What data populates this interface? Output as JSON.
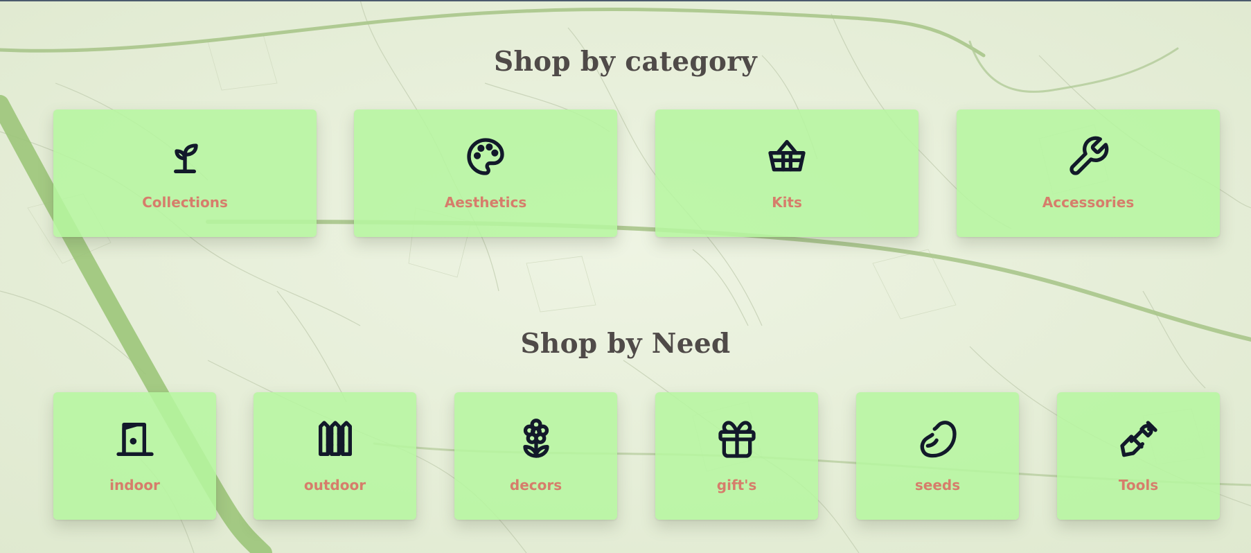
{
  "sections": [
    {
      "title": "Shop by category",
      "items": [
        {
          "label": "Collections",
          "icon": "sprout-icon"
        },
        {
          "label": "Aesthetics",
          "icon": "palette-icon"
        },
        {
          "label": "Kits",
          "icon": "basket-icon"
        },
        {
          "label": "Accessories",
          "icon": "wrench-icon"
        }
      ]
    },
    {
      "title": "Shop by Need",
      "items": [
        {
          "label": "indoor",
          "icon": "door-icon"
        },
        {
          "label": "outdoor",
          "icon": "fence-icon"
        },
        {
          "label": "decors",
          "icon": "flower-icon"
        },
        {
          "label": "gift's",
          "icon": "gift-icon"
        },
        {
          "label": "seeds",
          "icon": "bean-icon"
        },
        {
          "label": "Tools",
          "icon": "shovel-icon"
        }
      ]
    }
  ],
  "colors": {
    "card_background": "#b6f6a0",
    "label_color": "#d67d6b",
    "title_color": "#4f4a48",
    "icon_color": "#12192a"
  }
}
